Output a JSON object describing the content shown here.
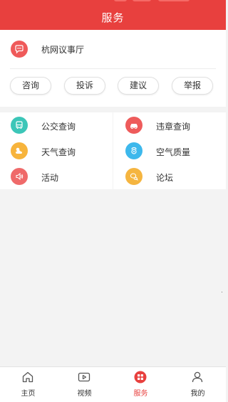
{
  "header": {
    "title": "服务"
  },
  "featured": {
    "label": "杭网议事厅",
    "icon": "chat-bubble-icon",
    "icon_color": "#ef5a5a"
  },
  "pills": [
    {
      "label": "咨询"
    },
    {
      "label": "投诉"
    },
    {
      "label": "建议"
    },
    {
      "label": "举报"
    }
  ],
  "services": [
    {
      "label": "公交查询",
      "icon": "bus-icon",
      "color": "#3cc6b8"
    },
    {
      "label": "违章查询",
      "icon": "car-icon",
      "color": "#ee5b5b"
    },
    {
      "label": "天气查询",
      "icon": "weather-icon",
      "color": "#f7b43c"
    },
    {
      "label": "空气质量",
      "icon": "air-quality-icon",
      "color": "#3db8ec"
    },
    {
      "label": "活动",
      "icon": "speaker-icon",
      "color": "#ef6a6a"
    },
    {
      "label": "论坛",
      "icon": "forum-icon",
      "color": "#f5b540"
    }
  ],
  "tabbar": {
    "active_color": "#e8403e",
    "items": [
      {
        "label": "主页",
        "icon": "home-icon"
      },
      {
        "label": "视频",
        "icon": "video-icon"
      },
      {
        "label": "服务",
        "icon": "services-icon",
        "active": true
      },
      {
        "label": "我的",
        "icon": "profile-icon"
      }
    ]
  }
}
